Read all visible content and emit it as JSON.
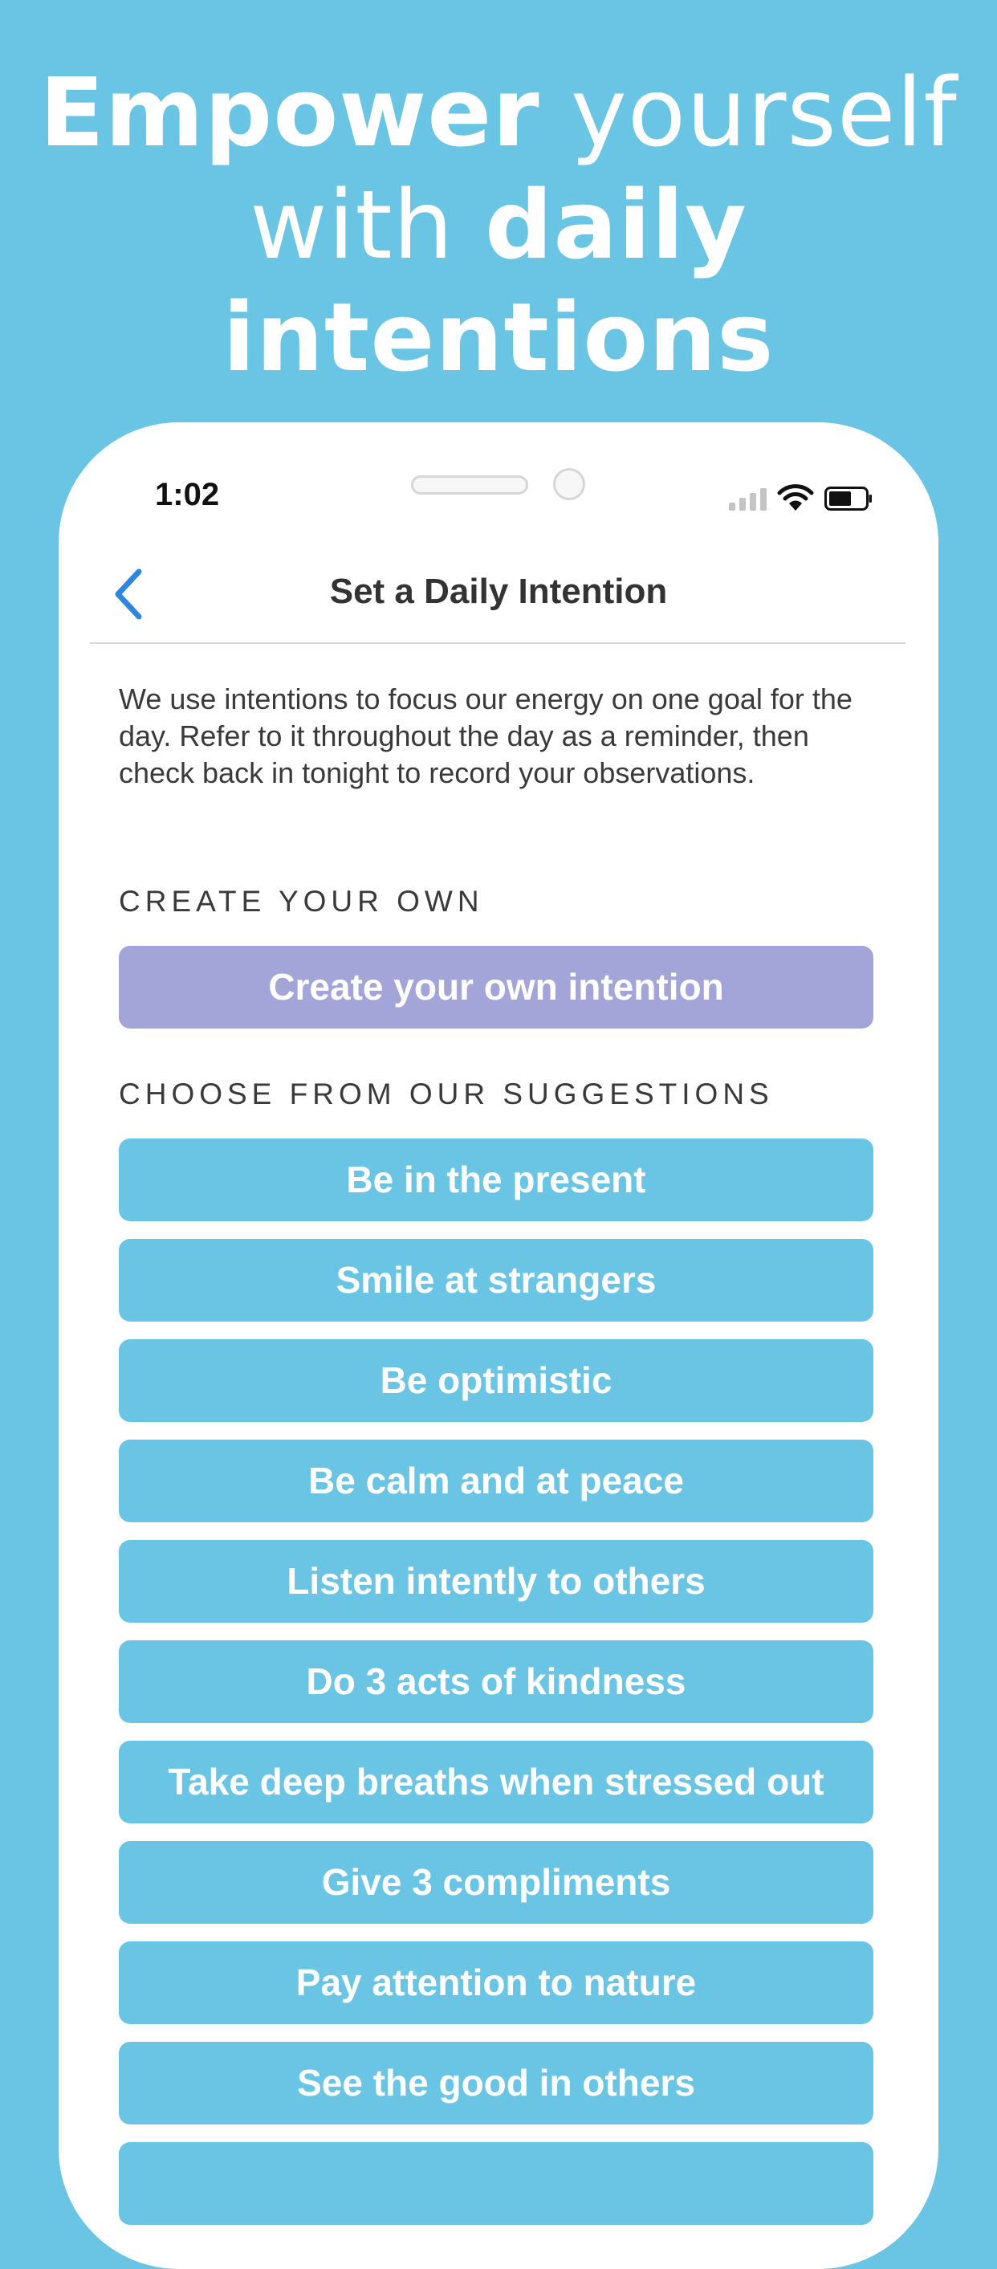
{
  "headline": {
    "line1_bold": "Empower",
    "line1_light": " yourself",
    "line2_light": "with ",
    "line2_bold": "daily",
    "line3_bold": "intentions"
  },
  "status_bar": {
    "time": "1:02",
    "icons": [
      "cellular-signal-icon",
      "wifi-icon",
      "battery-icon"
    ]
  },
  "nav": {
    "back_icon": "chevron-left-icon",
    "title": "Set a Daily Intention"
  },
  "intro": "We use intentions to focus our energy on one goal for the day. Refer to it throughout the day as a reminder, then check back in tonight to record your observations.",
  "create_section": {
    "label": "CREATE YOUR OWN",
    "button_label": "Create your own intention"
  },
  "suggestions_section": {
    "label": "CHOOSE FROM OUR SUGGESTIONS",
    "items": [
      "Be in the present",
      "Smile at strangers",
      "Be optimistic",
      "Be calm and at peace",
      "Listen intently to others",
      "Do 3 acts of kindness",
      "Take deep breaths when stressed out",
      "Give 3 compliments",
      "Pay attention to nature",
      "See the good in others",
      ""
    ]
  },
  "colors": {
    "background": "#6ac5e5",
    "create_button": "#a3a5d9",
    "suggestion_button": "#6ac5e5",
    "accent": "#2e86de"
  }
}
